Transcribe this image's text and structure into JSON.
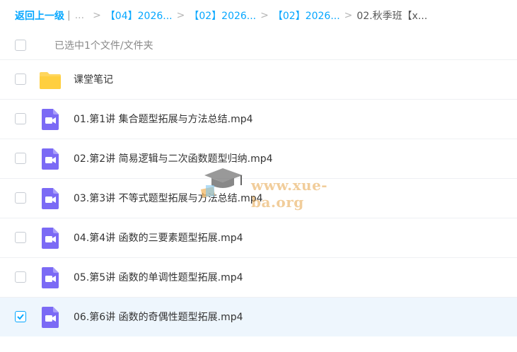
{
  "breadcrumb": {
    "back_label": "返回上一级",
    "ellipsis": "...",
    "items": [
      "【04】2026...",
      "【02】2026...",
      "【02】2026..."
    ],
    "current": "02.秋季班【x...",
    "separator": ">"
  },
  "selection": {
    "text": "已选中1个文件/文件夹"
  },
  "files": [
    {
      "name": "课堂笔记",
      "type": "folder",
      "checked": false
    },
    {
      "name": "01.第1讲 集合题型拓展与方法总结.mp4",
      "type": "video",
      "checked": false
    },
    {
      "name": "02.第2讲 简易逻辑与二次函数题型归纳.mp4",
      "type": "video",
      "checked": false
    },
    {
      "name": "03.第3讲 不等式题型拓展与方法总结.mp4",
      "type": "video",
      "checked": false
    },
    {
      "name": "04.第4讲 函数的三要素题型拓展.mp4",
      "type": "video",
      "checked": false
    },
    {
      "name": "05.第5讲 函数的单调性题型拓展.mp4",
      "type": "video",
      "checked": false
    },
    {
      "name": "06.第6讲 函数的奇偶性题型拓展.mp4",
      "type": "video",
      "checked": true
    }
  ],
  "watermark": {
    "text": "www.xue-ba.org"
  },
  "colors": {
    "accent": "#06a7ff",
    "folder": "#ffd65c",
    "video": "#7b6af5",
    "selected_row": "#eef6fd"
  }
}
